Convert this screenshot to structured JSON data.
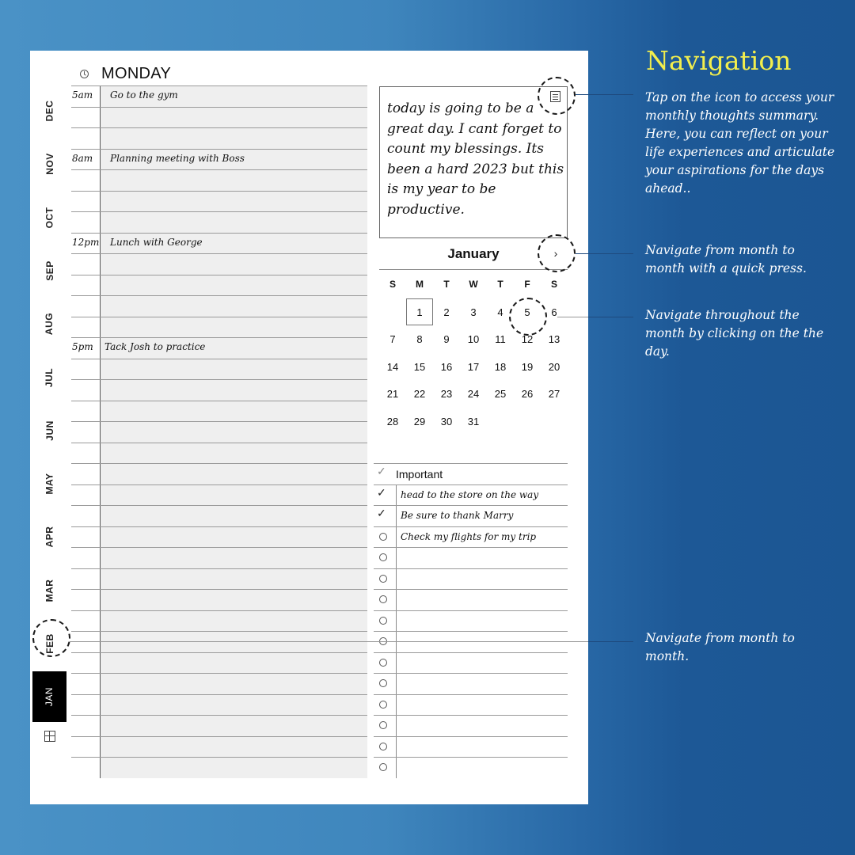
{
  "planner": {
    "day_title": "MONDAY",
    "months": [
      "DEC",
      "NOV",
      "OCT",
      "SEP",
      "AUG",
      "JUL",
      "JUN",
      "MAY",
      "APR",
      "MAR",
      "FEB",
      "JAN"
    ],
    "active_month": "JAN",
    "schedule": [
      {
        "time": "5am",
        "text": "Go to the gym"
      },
      {
        "time": "",
        "text": ""
      },
      {
        "time": "",
        "text": ""
      },
      {
        "time": "8am",
        "text": "Planning meeting with Boss"
      },
      {
        "time": "",
        "text": ""
      },
      {
        "time": "",
        "text": ""
      },
      {
        "time": "",
        "text": ""
      },
      {
        "time": "12pm",
        "text": "Lunch with George"
      },
      {
        "time": "",
        "text": ""
      },
      {
        "time": "",
        "text": ""
      },
      {
        "time": "",
        "text": ""
      },
      {
        "time": "",
        "text": ""
      },
      {
        "time": "5pm",
        "text": "Tack Josh to practice"
      }
    ],
    "thoughts": "today is going to be a great day.  I cant forget to count my blessings. Its been a hard 2023 but this is my year to be productive.",
    "calendar": {
      "month": "January",
      "weekdays": [
        "S",
        "M",
        "T",
        "W",
        "T",
        "F",
        "S"
      ],
      "first_weekday_index": 1,
      "days_in_month": 31,
      "selected_day": 1,
      "highlighted_day": 5
    },
    "tasks": {
      "header": "Important",
      "items": [
        {
          "text": "head to the store on the way",
          "done": true
        },
        {
          "text": "Be sure to thank Marry",
          "done": true
        },
        {
          "text": "Check my flights for my trip",
          "done": false
        }
      ],
      "empty_rows": 11
    }
  },
  "annotations": {
    "title": "Navigation",
    "notes": [
      "Tap on the icon to access your monthly thoughts summary. Here, you can reflect on your life experiences and articulate your aspirations for the days ahead..",
      "Navigate from month to month with a quick press.",
      "Navigate throughout the month by clicking on the the day.",
      "Navigate from month to month."
    ]
  },
  "icons": {
    "clock": "clock-icon",
    "notes": "notes-icon",
    "next": "chevron-right-icon",
    "grid": "grid-icon",
    "check": "✓"
  },
  "colors": {
    "annotation_title": "#f2ee4d",
    "active_tab": "#000000",
    "background_left": "#4a92c6",
    "background_right": "#1b5693"
  }
}
